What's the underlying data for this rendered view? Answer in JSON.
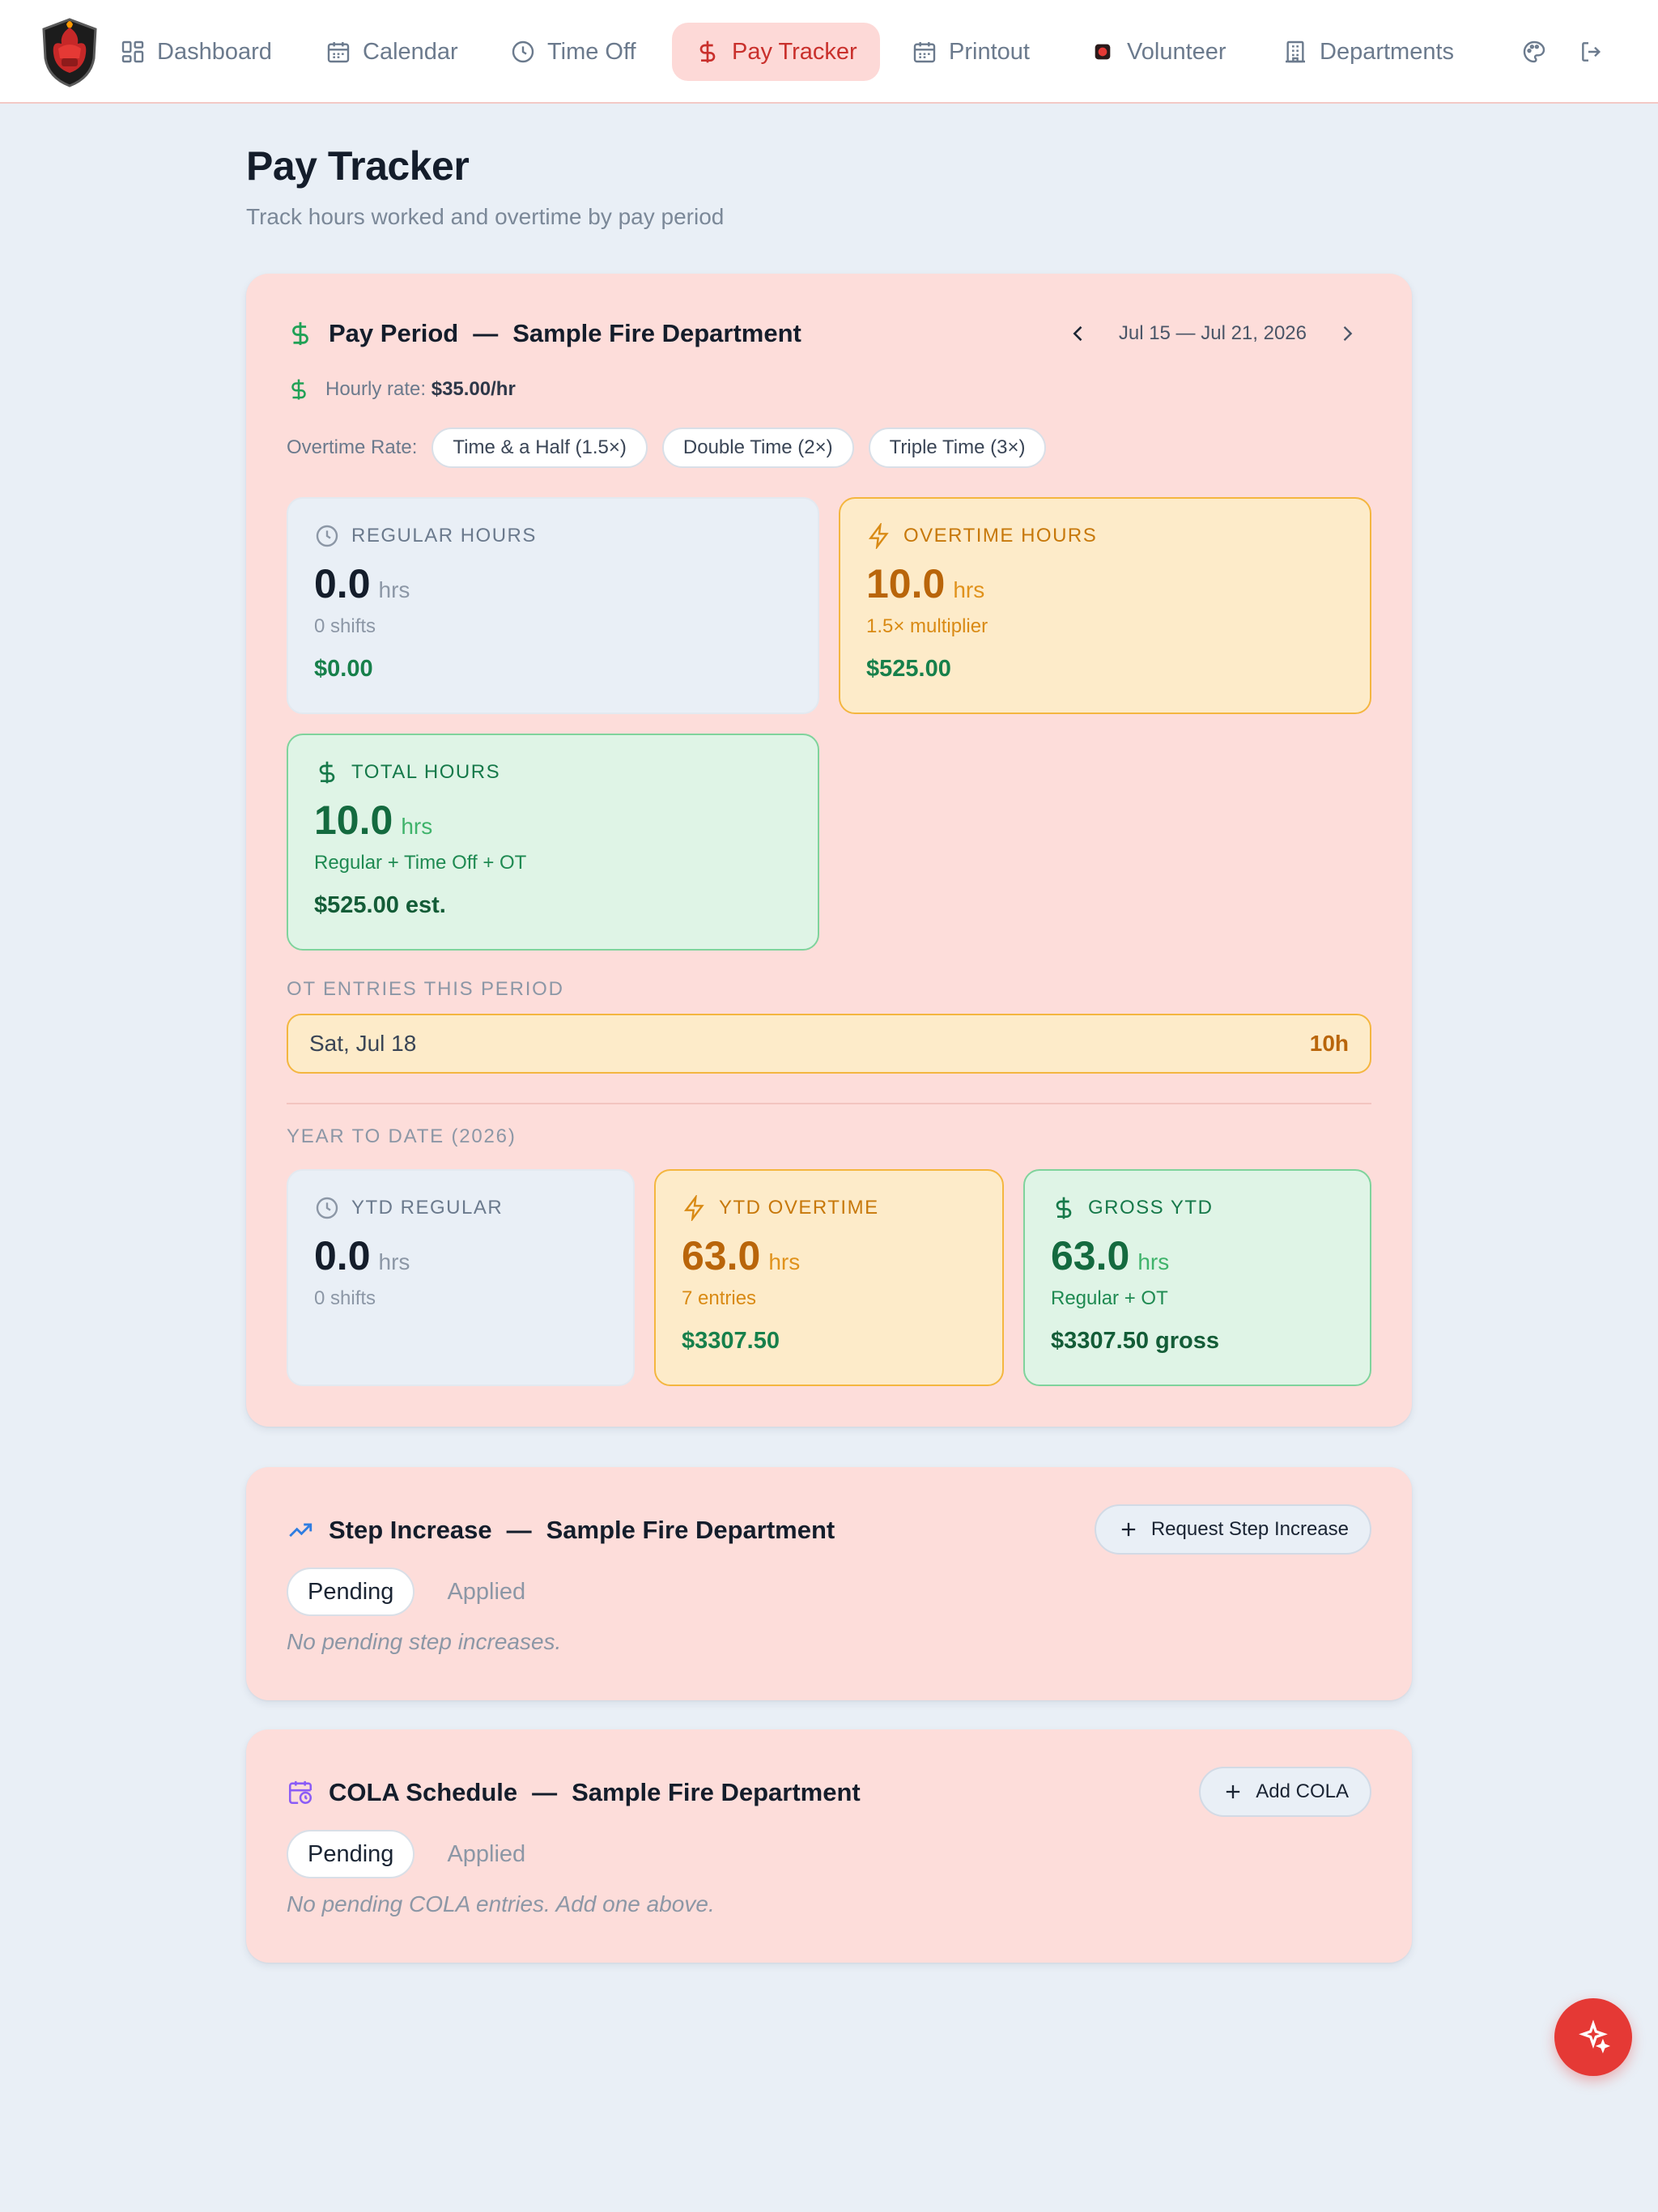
{
  "nav": {
    "items": [
      {
        "label": "Dashboard",
        "icon": "dashboard-icon"
      },
      {
        "label": "Calendar",
        "icon": "calendar-icon"
      },
      {
        "label": "Time Off",
        "icon": "clock-icon"
      },
      {
        "label": "Pay Tracker",
        "icon": "dollar-icon",
        "active": true
      },
      {
        "label": "Printout",
        "icon": "calendar-icon"
      },
      {
        "label": "Volunteer",
        "icon": "volunteer-badge-icon"
      },
      {
        "label": "Departments",
        "icon": "building-icon"
      }
    ],
    "utility_icons": [
      "palette-icon",
      "logout-icon"
    ]
  },
  "header": {
    "title": "Pay Tracker",
    "subtitle": "Track hours worked and overtime by pay period"
  },
  "pay_period": {
    "title": "Pay Period",
    "separator": "—",
    "department": "Sample Fire Department",
    "range": "Jul 15 — Jul 21, 2026",
    "hourly_rate_label": "Hourly rate:",
    "hourly_rate_value": "$35.00/hr",
    "overtime_rate_label": "Overtime Rate:",
    "overtime_options": [
      "Time & a Half (1.5×)",
      "Double Time (2×)",
      "Triple Time (3×)"
    ],
    "regular": {
      "label": "Regular Hours",
      "value": "0.0",
      "unit": "hrs",
      "sub": "0 shifts",
      "money": "$0.00"
    },
    "overtime": {
      "label": "Overtime Hours",
      "value": "10.0",
      "unit": "hrs",
      "sub": "1.5× multiplier",
      "money": "$525.00"
    },
    "total": {
      "label": "Total Hours",
      "value": "10.0",
      "unit": "hrs",
      "sub": "Regular + Time Off + OT",
      "money": "$525.00 est."
    },
    "ot_entries_label": "OT Entries This Period",
    "ot_entries": [
      {
        "date": "Sat, Jul 18",
        "hours": "10h"
      }
    ],
    "ytd_label": "Year to Date (2026)",
    "ytd_regular": {
      "label": "YTD Regular",
      "value": "0.0",
      "unit": "hrs",
      "sub": "0 shifts"
    },
    "ytd_overtime": {
      "label": "YTD Overtime",
      "value": "63.0",
      "unit": "hrs",
      "sub": "7 entries",
      "money": "$3307.50"
    },
    "gross_ytd": {
      "label": "Gross YTD",
      "value": "63.0",
      "unit": "hrs",
      "sub": "Regular + OT",
      "money": "$3307.50 gross"
    }
  },
  "step_increase": {
    "title": "Step Increase",
    "separator": "—",
    "department": "Sample Fire Department",
    "button": "Request Step Increase",
    "tabs": [
      "Pending",
      "Applied"
    ],
    "empty": "No pending step increases."
  },
  "cola": {
    "title": "COLA Schedule",
    "separator": "—",
    "department": "Sample Fire Department",
    "button": "Add COLA",
    "tabs": [
      "Pending",
      "Applied"
    ],
    "empty": "No pending COLA entries. Add one above."
  },
  "colors": {
    "accent": "#e53935",
    "card_bg": "#fdddda",
    "page_bg": "#e9eff6",
    "amber": "#f4b63f",
    "green": "#7fd39c"
  }
}
